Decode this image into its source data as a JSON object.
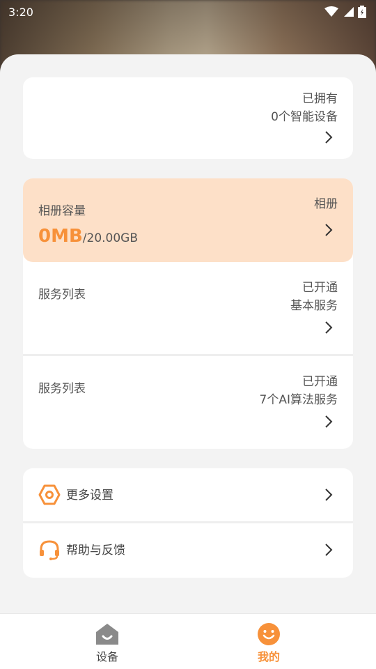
{
  "status_bar": {
    "time": "3:20"
  },
  "devices_card": {
    "line1": "已拥有",
    "line2": "0个智能设备"
  },
  "album": {
    "title": "相册容量",
    "used": "0MB",
    "total": "/20.00GB",
    "link_label": "相册"
  },
  "services": [
    {
      "title": "服务列表",
      "line1": "已开通",
      "line2": "基本服务"
    },
    {
      "title": "服务列表",
      "line1": "已开通",
      "line2": "7个AI算法服务"
    }
  ],
  "menu": {
    "settings_label": "更多设置",
    "help_label": "帮助与反馈"
  },
  "bottom_nav": {
    "devices_label": "设备",
    "mine_label": "我的",
    "active": "mine"
  },
  "colors": {
    "accent": "#f7913a",
    "album_bg": "#fde0c8",
    "text": "#555555",
    "icon_gray": "#8a8a8a"
  },
  "icons": [
    "wifi-icon",
    "cell-signal-icon",
    "battery-icon",
    "chevron-right-icon",
    "settings-hexagon-icon",
    "headset-icon",
    "home-icon",
    "smile-icon"
  ]
}
